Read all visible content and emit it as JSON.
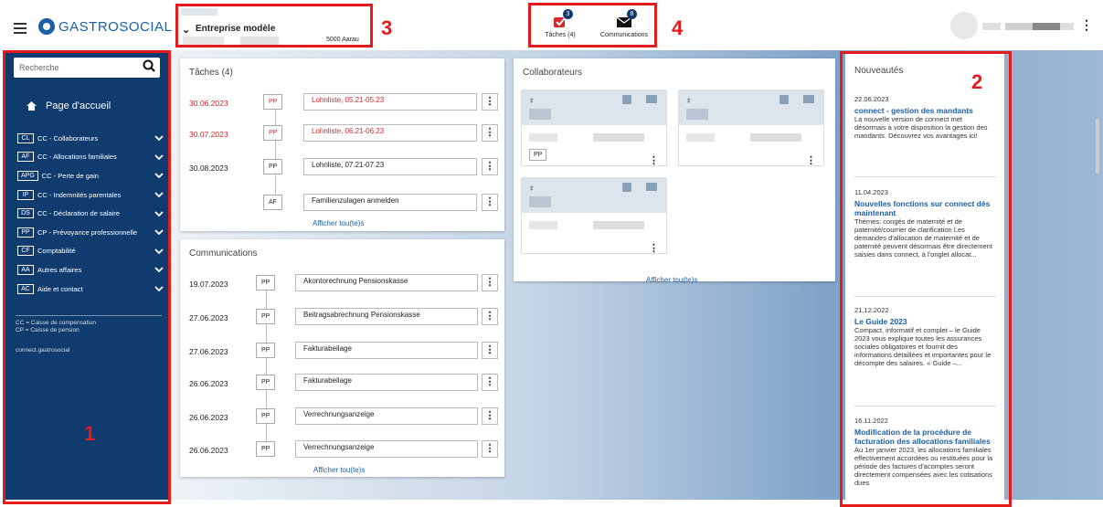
{
  "app": {
    "brand": "GASTROSOCIAL"
  },
  "company": {
    "name": "Entreprise modèle",
    "city": "5000 Aarau"
  },
  "top_nav": {
    "tasks_label": "Tâches (4)",
    "tasks_badge": "3",
    "comms_label": "Communications",
    "comms_badge": "8"
  },
  "sidebar": {
    "search_placeholder": "Recherche",
    "home_label": "Page d'accueil",
    "items": [
      {
        "code": "CL",
        "label": "CC - Collaborateurs"
      },
      {
        "code": "AF",
        "label": "CC - Allocations familiales"
      },
      {
        "code": "APG",
        "label": "CC - Perte de gain"
      },
      {
        "code": "IP",
        "label": "CC - Indemnités parentales"
      },
      {
        "code": "DS",
        "label": "CC - Déclaration de salaire"
      },
      {
        "code": "PP",
        "label": "CP - Prévoyance professionnelle"
      },
      {
        "code": "CF",
        "label": "Comptabilité"
      },
      {
        "code": "AA",
        "label": "Autres affaires"
      },
      {
        "code": "AC",
        "label": "Aide et contact"
      }
    ],
    "legend_cc": "CC = Caisse de compensation",
    "legend_cp": "CP = Caisse de pension",
    "link": "connect.gastrosocial"
  },
  "tasks": {
    "title": "Tâches (4)",
    "rows": [
      {
        "date": "30.06.2023",
        "tag": "PP",
        "msg": "Lohnliste, 05.21-05.23",
        "overdue": true
      },
      {
        "date": "30.07.2023",
        "tag": "PP",
        "msg": "Lohnliste, 06.21-06.23",
        "overdue": true
      },
      {
        "date": "30.08.2023",
        "tag": "PP",
        "msg": "Lohnliste, 07.21-07.23",
        "overdue": false
      },
      {
        "date": "",
        "tag": "AF",
        "msg": "Familienzulagen anmelden",
        "overdue": false
      }
    ],
    "show_all": "Afficher tou(te)s"
  },
  "communications": {
    "title": "Communications",
    "rows": [
      {
        "date": "19.07.2023",
        "tag": "PP",
        "msg": "Akontorechnung Pensionskasse"
      },
      {
        "date": "27.06.2023",
        "tag": "PP",
        "msg": "Beitragsabrechnung Pensionskasse"
      },
      {
        "date": "27.06.2023",
        "tag": "PP",
        "msg": "Fakturabeilage"
      },
      {
        "date": "26.06.2023",
        "tag": "PP",
        "msg": "Fakturabeilage"
      },
      {
        "date": "26.06.2023",
        "tag": "PP",
        "msg": "Verrechnungsanzeige"
      },
      {
        "date": "26.06.2023",
        "tag": "PP",
        "msg": "Verrechnungsanzeige"
      }
    ],
    "show_all": "Afficher tou(te)s"
  },
  "collaborators": {
    "title": "Collaborateurs",
    "card_tag": "PP",
    "show_all": "Afficher tou(te)s"
  },
  "news": {
    "title": "Nouveautés",
    "items": [
      {
        "date": "22.06.2023",
        "heading": "connect - gestion des mandants",
        "body": "La nouvelle version de connect met désormais à votre disposition la gestion des mandants. Découvrez vos avantages ici!"
      },
      {
        "date": "11.04.2023",
        "heading": "Nouvelles fonctions sur connect dès maintenant",
        "body": "Thèmes: congés de maternité et de paternité/courrier de clarification Les demandes d'allocation de maternité et de paternité peuvent désormais être directement saisies dans connect, à l'onglet allocat..."
      },
      {
        "date": "21.12.2022",
        "heading": "Le Guide 2023",
        "body": "Compact, informatif et complet – le Guide 2023 vous explique toutes les assurances sociales obligatoires et fournit des informations détaillées et importantes pour le décompte des salaires. « Guide –..."
      },
      {
        "date": "16.11.2022",
        "heading": "Modification de la procédure de facturation des allocations familiales",
        "body": "Au 1er janvier 2023, les allocations familiales effectivement accordées ou restituées pour la période des factures d'acomptes seront directement compensées avec les cotisations dues"
      }
    ]
  },
  "annotations": {
    "n1": "1",
    "n2": "2",
    "n3": "3",
    "n4": "4"
  },
  "colors": {
    "brand": "#1a5fa8",
    "sidebar": "#0f3b6e",
    "overdue": "#d9262b",
    "annotation": "#e31b1b"
  }
}
